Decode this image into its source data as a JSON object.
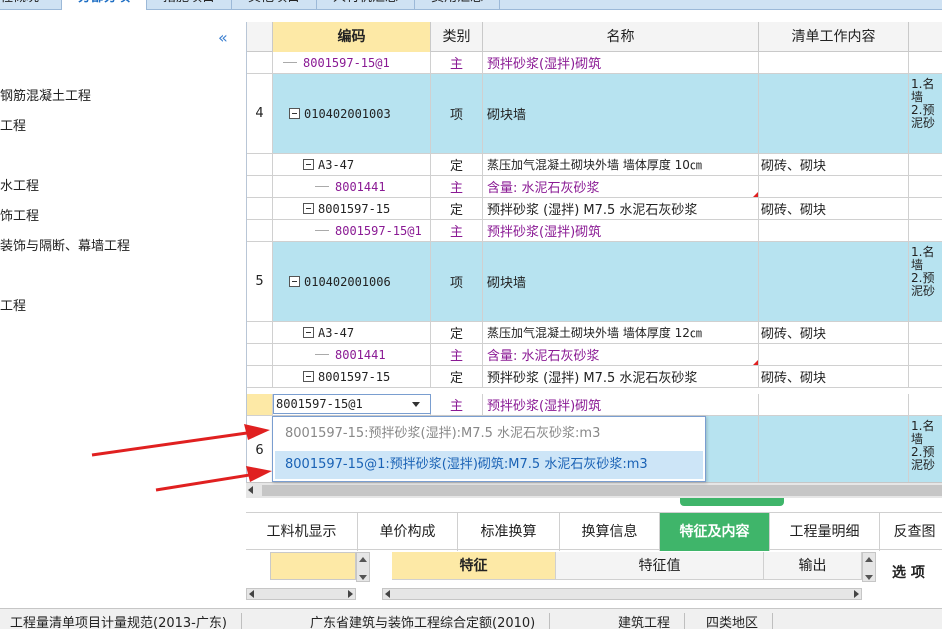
{
  "top_tabs": [
    "程概况",
    "分部分项",
    "措施项目",
    "其他项目",
    "人材机汇总",
    "费用汇总"
  ],
  "tree": {
    "items": [
      "钢筋混凝土工程",
      "工程",
      "水工程",
      "饰工程",
      "装饰与隔断、幕墙工程",
      "工程"
    ]
  },
  "grid": {
    "headers": {
      "code": "编码",
      "type": "类别",
      "name": "名称",
      "work": "清单工作内容"
    },
    "rows": [
      {
        "kind": "sub",
        "code": "8001597-15@1",
        "type": "主",
        "name": "预拌砂浆(湿拌)砌筑"
      },
      {
        "kind": "item",
        "seq": "4",
        "code": "010402001003",
        "type": "项",
        "name": "砌块墙",
        "desc": "1.名\n墙\n2.预\n泥砂"
      },
      {
        "kind": "quota",
        "code": "A3-47",
        "type": "定",
        "name": "蒸压加气混凝土砌块外墙 墙体厚度 10㎝",
        "work": "砌砖、砌块"
      },
      {
        "kind": "sub",
        "code": "8001441",
        "type": "主",
        "name": "含量: 水泥石灰砂浆"
      },
      {
        "kind": "quota",
        "code": "8001597-15",
        "type": "定",
        "name": "预拌砂浆 (湿拌) M7.5 水泥石灰砂浆",
        "work": "砌砖、砌块"
      },
      {
        "kind": "sub",
        "code": "8001597-15@1",
        "type": "主",
        "name": "预拌砂浆(湿拌)砌筑"
      },
      {
        "kind": "item",
        "seq": "5",
        "code": "010402001006",
        "type": "项",
        "name": "砌块墙",
        "desc": "1.名\n墙\n2.预\n泥砂"
      },
      {
        "kind": "quota",
        "code": "A3-47",
        "type": "定",
        "name": "蒸压加气混凝土砌块外墙 墙体厚度 12㎝",
        "work": "砌砖、砌块"
      },
      {
        "kind": "sub",
        "code": "8001441",
        "type": "主",
        "name": "含量: 水泥石灰砂浆"
      },
      {
        "kind": "quota",
        "code": "8001597-15",
        "type": "定",
        "name": "预拌砂浆 (湿拌) M7.5 水泥石灰砂浆",
        "work": "砌砖、砌块"
      },
      {
        "kind": "edit",
        "type": "主",
        "name": "预拌砂浆(湿拌)砌筑"
      },
      {
        "kind": "item-partial",
        "seq": "6",
        "desc": "1.名\n墙\n2.预\n泥砂"
      }
    ],
    "edit_value": "8001597-15@1"
  },
  "dropdown": {
    "options": [
      "8001597-15:预拌砂浆(湿拌):M7.5 水泥石灰砂浆:m3",
      "8001597-15@1:预拌砂浆(湿拌)砌筑:M7.5 水泥石灰砂浆:m3"
    ]
  },
  "bottom_tabs": [
    "工料机显示",
    "单价构成",
    "标准换算",
    "换算信息",
    "特征及内容",
    "工程量明细",
    "反查图"
  ],
  "feature_panel": {
    "col_feature": "特征",
    "col_value": "特征值",
    "col_output": "输出",
    "option_label": "选 项"
  },
  "status_bar": [
    "工程量清单项目计量规范(2013-广东)",
    "广东省建筑与装饰工程综合定额(2010)",
    "建筑工程",
    "四类地区"
  ],
  "colors": {
    "item_row": "#b7e3f0",
    "active_tab": "#3fb56a",
    "code_header": "#fde9a6",
    "main_material_text": "#8a1a94",
    "arrow": "#e02020"
  }
}
